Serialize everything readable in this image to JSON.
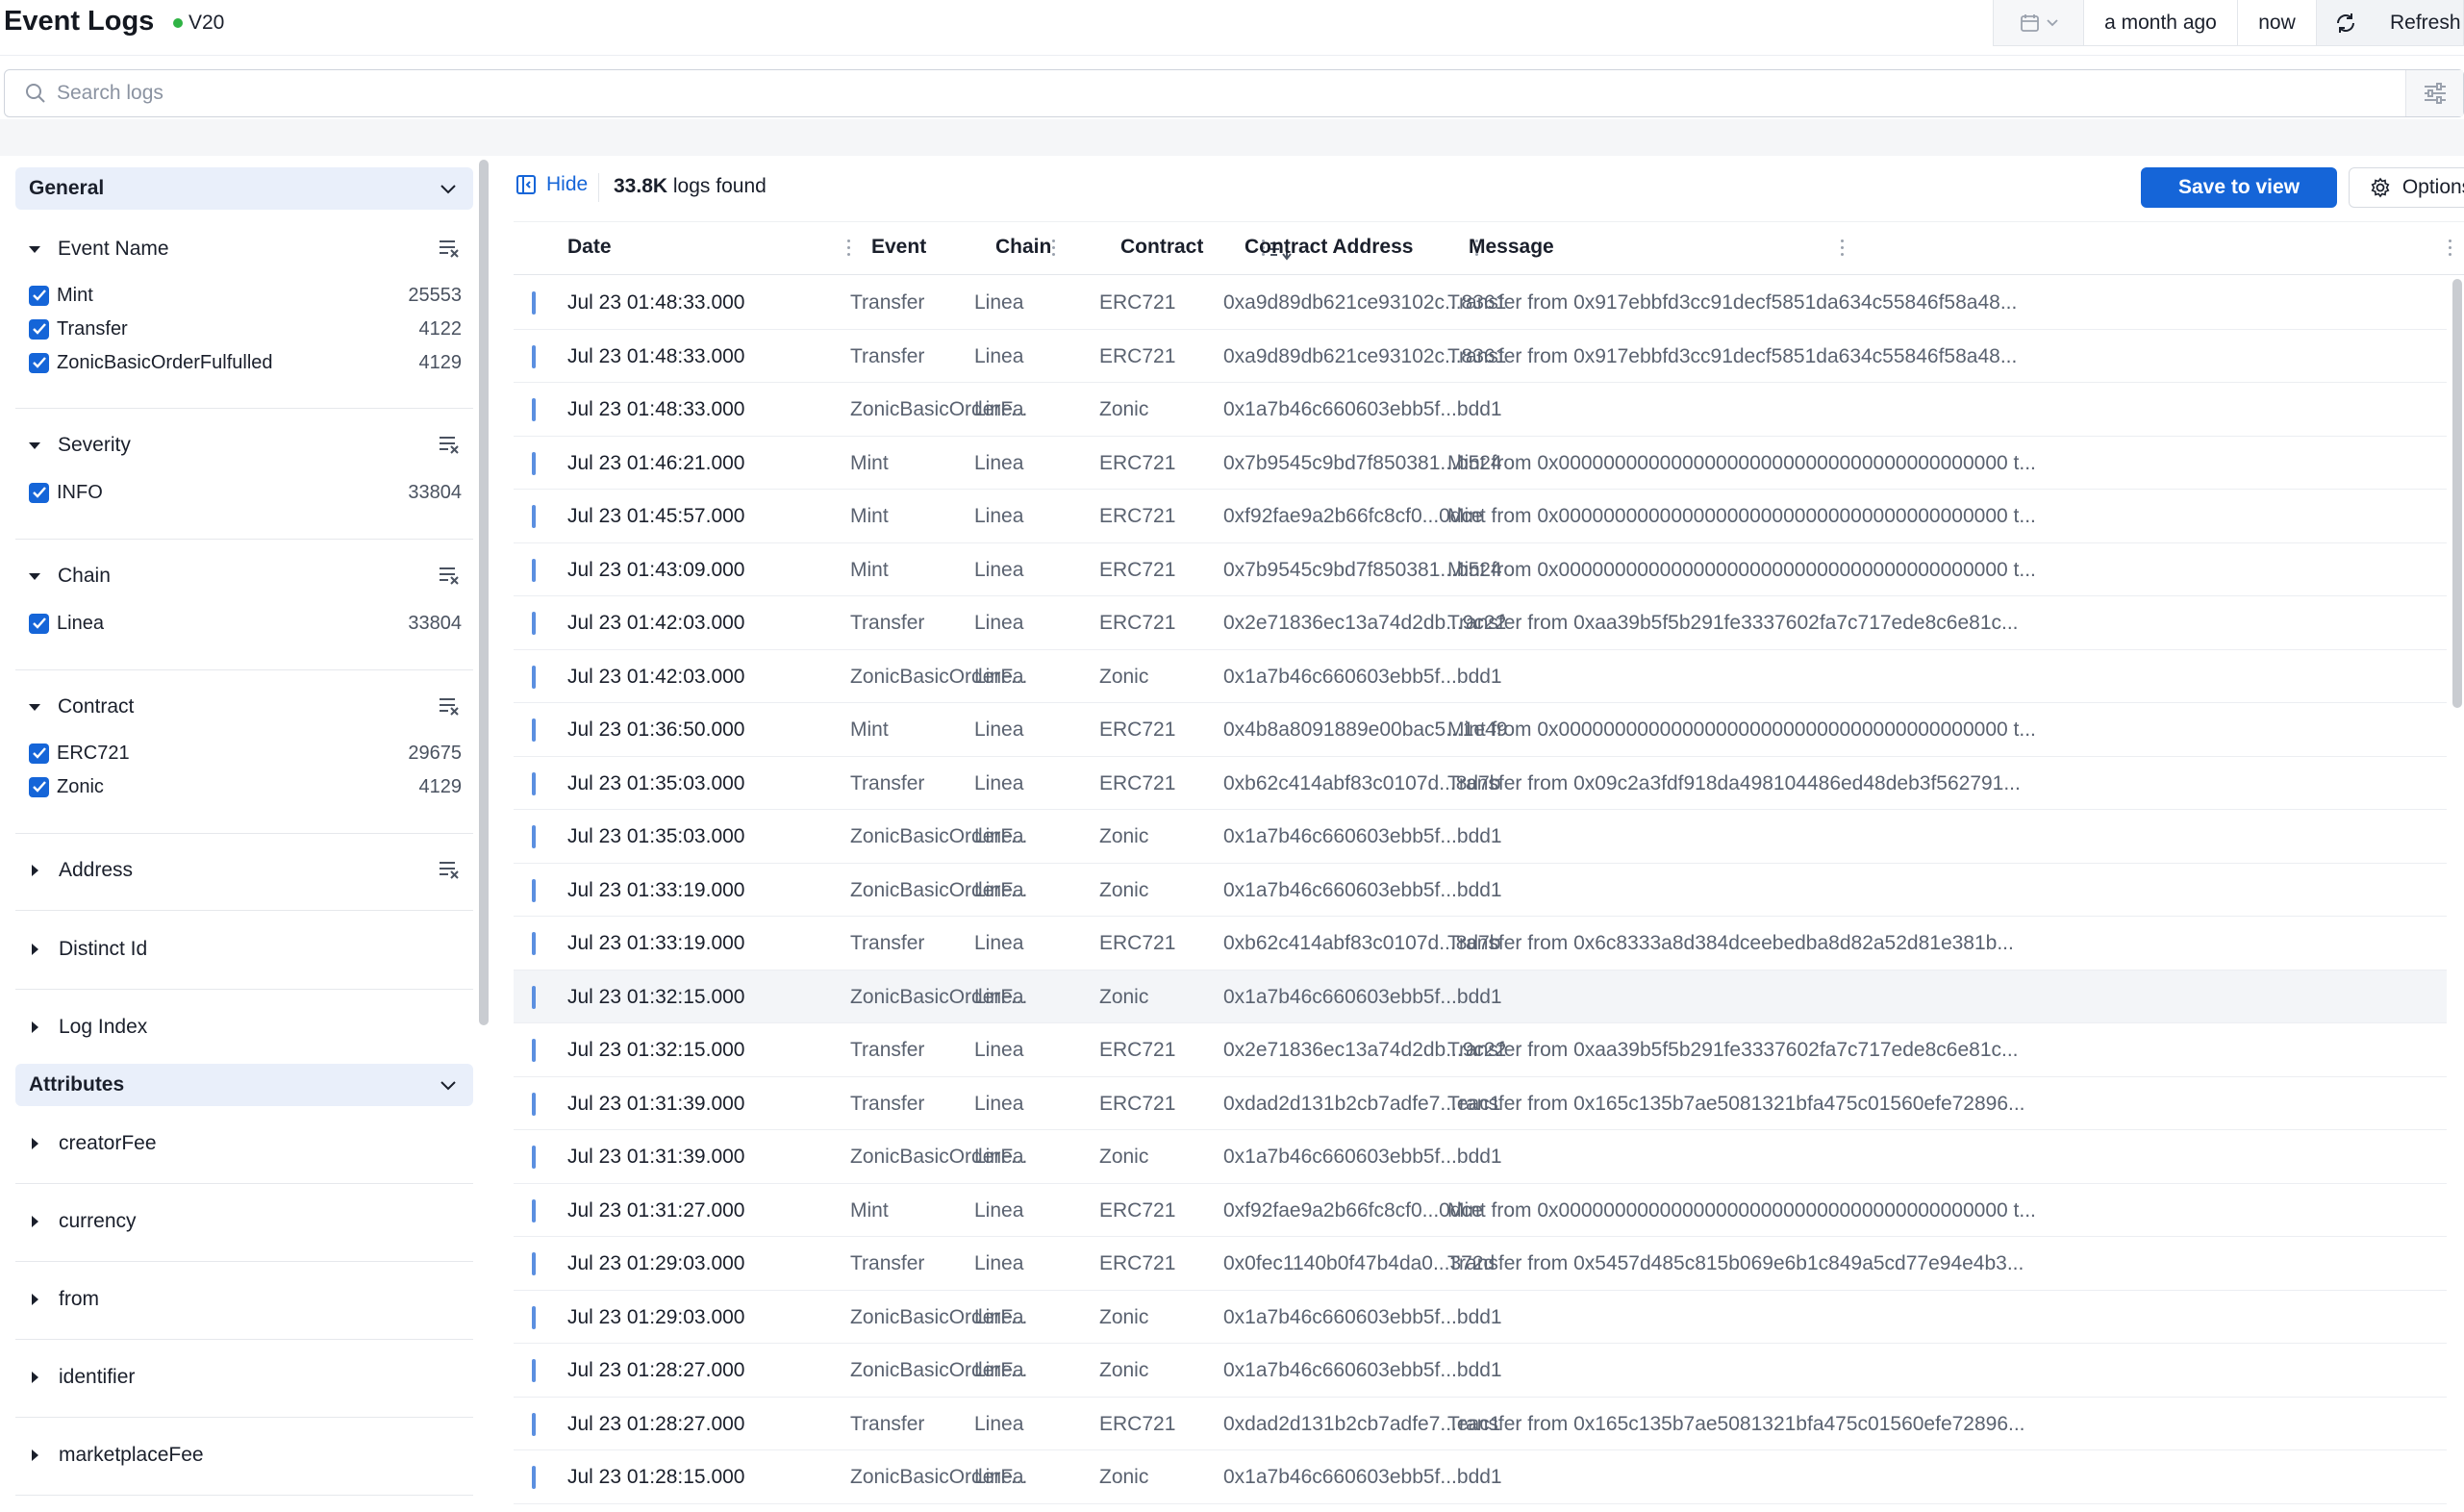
{
  "header": {
    "title": "Event Logs",
    "version": "V20",
    "status_color": "#2fb344",
    "time_from": "a month ago",
    "time_to": "now",
    "refresh_label": "Refresh"
  },
  "search": {
    "placeholder": "Search logs"
  },
  "sidebar": {
    "general_label": "General",
    "attributes_label": "Attributes",
    "facets": [
      {
        "title": "Event Name",
        "items": [
          {
            "label": "Mint",
            "count": "25553"
          },
          {
            "label": "Transfer",
            "count": "4122"
          },
          {
            "label": "ZonicBasicOrderFulfulled",
            "count": "4129"
          }
        ]
      },
      {
        "title": "Severity",
        "items": [
          {
            "label": "INFO",
            "count": "33804"
          }
        ]
      },
      {
        "title": "Chain",
        "items": [
          {
            "label": "Linea",
            "count": "33804"
          }
        ]
      },
      {
        "title": "Contract",
        "items": [
          {
            "label": "ERC721",
            "count": "29675"
          },
          {
            "label": "Zonic",
            "count": "4129"
          }
        ]
      }
    ],
    "collapsed_facets": [
      "Address",
      "Distinct Id",
      "Log Index"
    ],
    "attributes": [
      "creatorFee",
      "currency",
      "from",
      "identifier",
      "marketplaceFee"
    ]
  },
  "toolbar": {
    "hide_label": "Hide",
    "logs_count": "33.8K",
    "logs_suffix": "logs found",
    "save_label": "Save to view",
    "options_label": "Options",
    "accent": "#1565d8"
  },
  "table": {
    "columns": [
      "Date",
      "Event",
      "Chain",
      "Contract",
      "Contract Address",
      "Message"
    ],
    "rows": [
      [
        "Jul 23 01:48:33.000",
        "Transfer",
        "Linea",
        "ERC721",
        "0xa9d89db621ce93102c...8361",
        "Transfer from 0x917ebbfd3cc91decf5851da634c55846f58a48..."
      ],
      [
        "Jul 23 01:48:33.000",
        "Transfer",
        "Linea",
        "ERC721",
        "0xa9d89db621ce93102c...8361",
        "Transfer from 0x917ebbfd3cc91decf5851da634c55846f58a48..."
      ],
      [
        "Jul 23 01:48:33.000",
        "ZonicBasicOrderF...",
        "Linea",
        "Zonic",
        "0x1a7b46c660603ebb5f...bdd1",
        ""
      ],
      [
        "Jul 23 01:46:21.000",
        "Mint",
        "Linea",
        "ERC721",
        "0x7b9545c9bd7f850381...b524",
        "Mint from 0x0000000000000000000000000000000000000000 t..."
      ],
      [
        "Jul 23 01:45:57.000",
        "Mint",
        "Linea",
        "ERC721",
        "0xf92fae9a2b66fc8cf0...0dce",
        "Mint from 0x0000000000000000000000000000000000000000 t..."
      ],
      [
        "Jul 23 01:43:09.000",
        "Mint",
        "Linea",
        "ERC721",
        "0x7b9545c9bd7f850381...b524",
        "Mint from 0x0000000000000000000000000000000000000000 t..."
      ],
      [
        "Jul 23 01:42:03.000",
        "Transfer",
        "Linea",
        "ERC721",
        "0x2e71836ec13a74d2db...9c22",
        "Transfer from 0xaa39b5f5b291fe3337602fa7c717ede8c6e81c..."
      ],
      [
        "Jul 23 01:42:03.000",
        "ZonicBasicOrderF...",
        "Linea",
        "Zonic",
        "0x1a7b46c660603ebb5f...bdd1",
        ""
      ],
      [
        "Jul 23 01:36:50.000",
        "Mint",
        "Linea",
        "ERC721",
        "0x4b8a8091889e00bac5...1e49",
        "Mint from 0x0000000000000000000000000000000000000000 t..."
      ],
      [
        "Jul 23 01:35:03.000",
        "Transfer",
        "Linea",
        "ERC721",
        "0xb62c414abf83c0107d...8d7b",
        "Transfer from 0x09c2a3fdf918da498104486ed48deb3f562791..."
      ],
      [
        "Jul 23 01:35:03.000",
        "ZonicBasicOrderF...",
        "Linea",
        "Zonic",
        "0x1a7b46c660603ebb5f...bdd1",
        ""
      ],
      [
        "Jul 23 01:33:19.000",
        "ZonicBasicOrderF...",
        "Linea",
        "Zonic",
        "0x1a7b46c660603ebb5f...bdd1",
        ""
      ],
      [
        "Jul 23 01:33:19.000",
        "Transfer",
        "Linea",
        "ERC721",
        "0xb62c414abf83c0107d...8d7b",
        "Transfer from 0x6c8333a8d384dceebedba8d82a52d81e381b..."
      ],
      [
        "Jul 23 01:32:15.000",
        "ZonicBasicOrderF...",
        "Linea",
        "Zonic",
        "0x1a7b46c660603ebb5f...bdd1",
        ""
      ],
      [
        "Jul 23 01:32:15.000",
        "Transfer",
        "Linea",
        "ERC721",
        "0x2e71836ec13a74d2db...9c22",
        "Transfer from 0xaa39b5f5b291fe3337602fa7c717ede8c6e81c..."
      ],
      [
        "Jul 23 01:31:39.000",
        "Transfer",
        "Linea",
        "ERC721",
        "0xdad2d131b2cb7adfe7...eac1",
        "Transfer from 0x165c135b7ae5081321bfa475c01560efe72896..."
      ],
      [
        "Jul 23 01:31:39.000",
        "ZonicBasicOrderF...",
        "Linea",
        "Zonic",
        "0x1a7b46c660603ebb5f...bdd1",
        ""
      ],
      [
        "Jul 23 01:31:27.000",
        "Mint",
        "Linea",
        "ERC721",
        "0xf92fae9a2b66fc8cf0...0dce",
        "Mint from 0x0000000000000000000000000000000000000000 t..."
      ],
      [
        "Jul 23 01:29:03.000",
        "Transfer",
        "Linea",
        "ERC721",
        "0x0fec1140b0f47b4da0...372d",
        "Transfer from 0x5457d485c815b069e6b1c849a5cd77e94e4b3..."
      ],
      [
        "Jul 23 01:29:03.000",
        "ZonicBasicOrderF...",
        "Linea",
        "Zonic",
        "0x1a7b46c660603ebb5f...bdd1",
        ""
      ],
      [
        "Jul 23 01:28:27.000",
        "ZonicBasicOrderF...",
        "Linea",
        "Zonic",
        "0x1a7b46c660603ebb5f...bdd1",
        ""
      ],
      [
        "Jul 23 01:28:27.000",
        "Transfer",
        "Linea",
        "ERC721",
        "0xdad2d131b2cb7adfe7...eac1",
        "Transfer from 0x165c135b7ae5081321bfa475c01560efe72896..."
      ],
      [
        "Jul 23 01:28:15.000",
        "ZonicBasicOrderF...",
        "Linea",
        "Zonic",
        "0x1a7b46c660603ebb5f...bdd1",
        ""
      ]
    ]
  }
}
